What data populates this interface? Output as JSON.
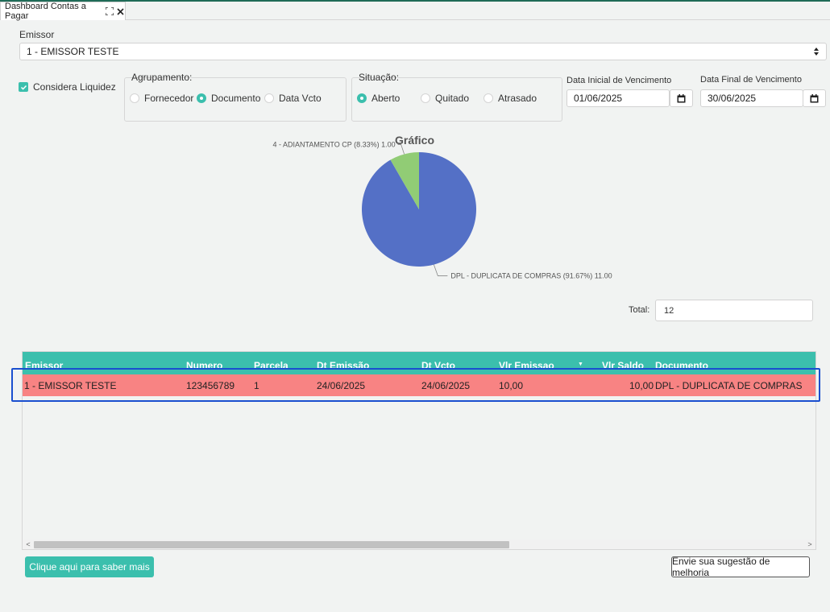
{
  "tab": {
    "title": "Dashboard Contas a Pagar"
  },
  "emissor": {
    "label": "Emissor",
    "selected": "1 - EMISSOR TESTE"
  },
  "considera_liquidez": {
    "label": "Considera Liquidez",
    "checked": true
  },
  "agrupamento": {
    "title": "Agrupamento:",
    "options": [
      {
        "label": "Fornecedor",
        "selected": false
      },
      {
        "label": "Documento",
        "selected": true
      },
      {
        "label": "Data Vcto",
        "selected": false
      }
    ]
  },
  "situacao": {
    "title": "Situação:",
    "options": [
      {
        "label": "Aberto",
        "selected": true
      },
      {
        "label": "Quitado",
        "selected": false
      },
      {
        "label": "Atrasado",
        "selected": false
      }
    ]
  },
  "data_inicial": {
    "label": "Data Inicial de Vencimento",
    "value": "01/06/2025"
  },
  "data_final": {
    "label": "Data Final de Vencimento",
    "value": "30/06/2025"
  },
  "chart_data": {
    "type": "pie",
    "title": "Gráfico",
    "slices": [
      {
        "name": "DPL - DUPLICATA DE COMPRAS",
        "value": 11.0,
        "percent": 91.67,
        "label": "DPL - DUPLICATA DE COMPRAS (91.67%) 11.00",
        "color": "#5470c6"
      },
      {
        "name": "4 - ADIANTAMENTO CP",
        "value": 1.0,
        "percent": 8.33,
        "label": "4   - ADIANTAMENTO CP (8.33%) 1.00",
        "color": "#91cc75"
      }
    ]
  },
  "total": {
    "label": "Total:",
    "value": "12"
  },
  "grid": {
    "columns": [
      "Emissor",
      "Numero",
      "Parcela",
      "Dt Emissão",
      "Dt Vcto",
      "Vlr Emissao",
      "Vlr Saldo",
      "Documento"
    ],
    "rows": [
      {
        "emissor": "1 - EMISSOR TESTE",
        "numero": "123456789",
        "parcela": "1",
        "dt_emissao": "24/06/2025",
        "dt_vcto": "24/06/2025",
        "vlr_emissao": "10,00",
        "vlr_saldo": "10,00",
        "documento": "DPL - DUPLICATA DE COMPRAS"
      }
    ]
  },
  "buttons": {
    "learn_more": "Clique aqui para saber mais",
    "suggestion": "Envie sua sugestão de melhoria"
  },
  "colors": {
    "accent": "#3bbfad",
    "row_highlight": "#f88383",
    "selection_border": "#1a4fcf"
  }
}
